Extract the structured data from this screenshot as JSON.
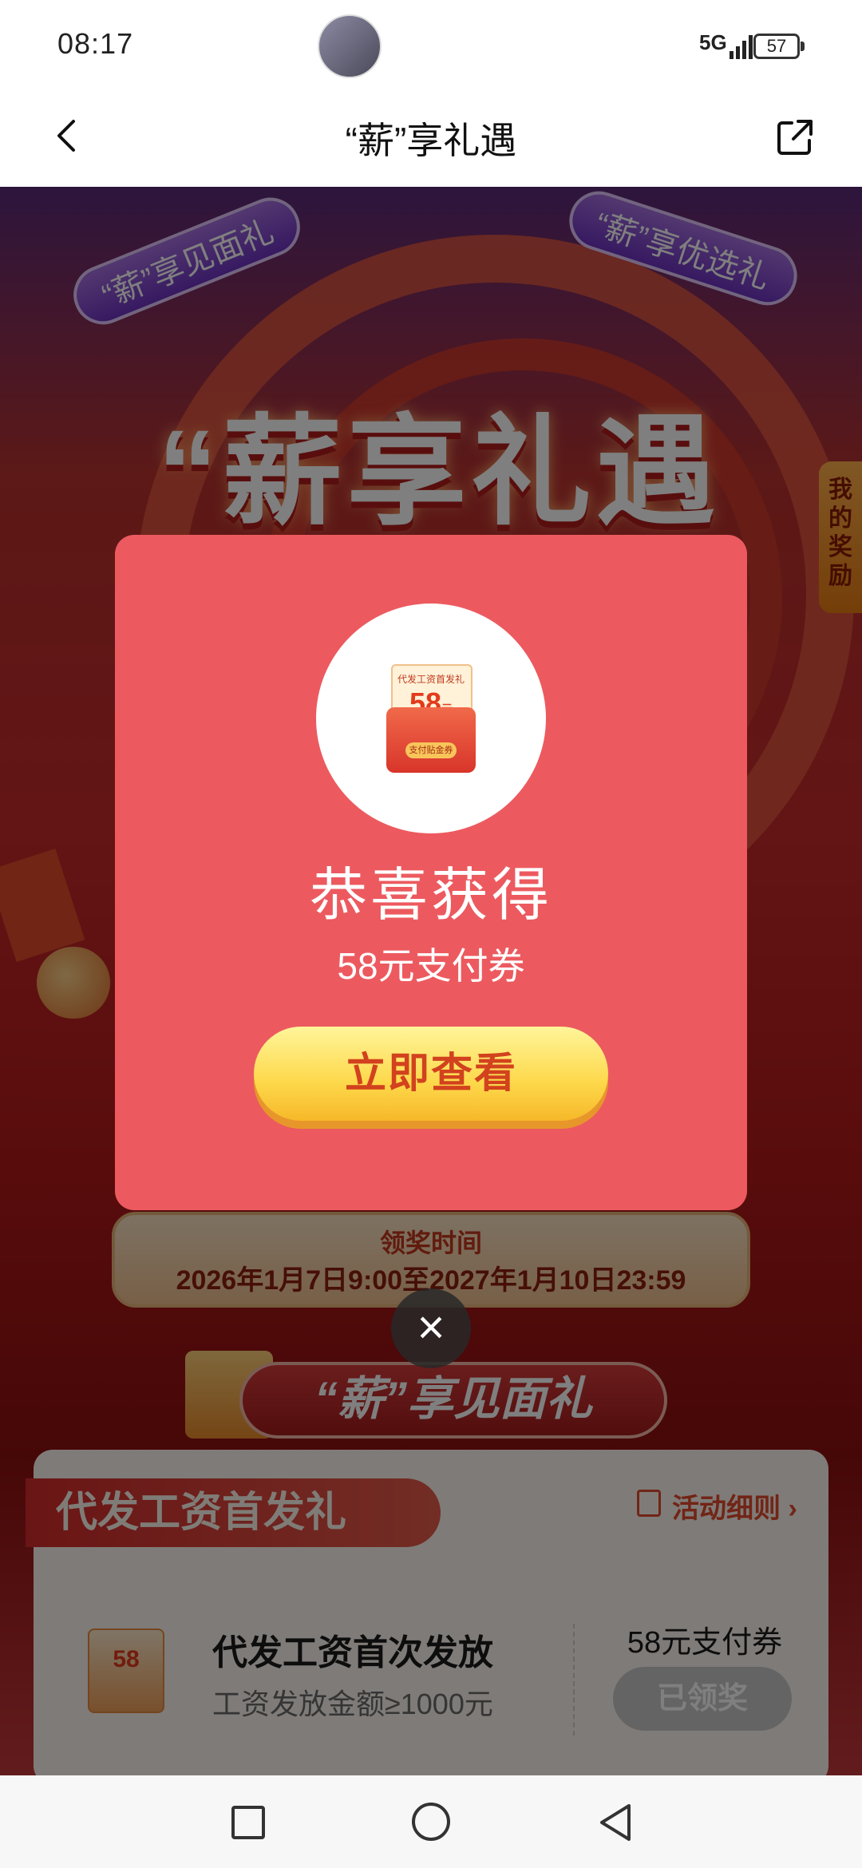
{
  "status_bar": {
    "time": "08:17",
    "network": "5G",
    "battery": "57"
  },
  "nav": {
    "title": "“薪”享礼遇"
  },
  "hero": {
    "ribbon_left": "“薪”享见面礼",
    "ribbon_right": "“薪”享优选礼",
    "title": "“薪享礼遇",
    "side_tab": "我的奖励"
  },
  "claim_period": {
    "title": "领奖时间",
    "range": "2026年1月7日9:00至2027年1月10日23:59"
  },
  "section": {
    "banner": "“薪”享见面礼",
    "card_title": "代发工资首发礼",
    "rules_link": "活动细则",
    "item": {
      "thumb_value": "58",
      "title": "代发工资首次发放",
      "subtitle": "工资发放金额≥1000元",
      "reward": "58元支付券",
      "button": "已领奖"
    }
  },
  "modal": {
    "voucher_top": "代发工资首发礼",
    "voucher_value": "58",
    "voucher_unit": "元",
    "voucher_tag": "支付贴金券",
    "title": "恭喜获得",
    "subtitle": "58元支付券",
    "button": "立即查看",
    "close": "×"
  }
}
